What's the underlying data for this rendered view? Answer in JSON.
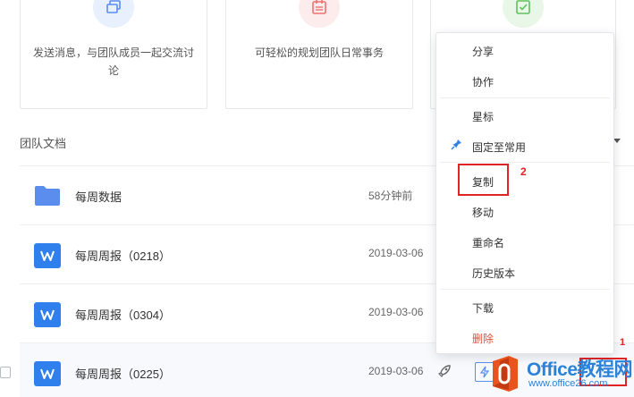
{
  "cards": [
    {
      "text": "发送消息，与团队成员一起交流讨论",
      "icon": "chat-icon"
    },
    {
      "text": "可轻松的规划团队日常事务",
      "icon": "calendar-icon"
    },
    {
      "text": "",
      "icon": "task-check-icon"
    }
  ],
  "section": {
    "title": "团队文档"
  },
  "files": [
    {
      "name": "每周数据",
      "time": "58分钟前",
      "type": "folder"
    },
    {
      "name": "每周周报（0218）",
      "time": "2019-03-06",
      "type": "doc"
    },
    {
      "name": "每周周报（0304）",
      "time": "2019-03-06",
      "type": "doc"
    },
    {
      "name": "每周周报（0225）",
      "time": "2019-03-06",
      "type": "doc"
    }
  ],
  "menu": {
    "share": "分享",
    "collaborate": "协作",
    "star": "星标",
    "pin": "固定至常用",
    "copy": "复制",
    "move": "移动",
    "rename": "重命名",
    "history": "历史版本",
    "download": "下载",
    "delete": "删除"
  },
  "annotations": {
    "marker_1": "1",
    "marker_2": "2"
  },
  "watermark": {
    "title": "Office教程网",
    "url": "www.office26.com"
  },
  "colors": {
    "accent": "#2f80ed",
    "folder": "#5b8def",
    "highlight_box": "#e02424",
    "danger": "#e0503a"
  }
}
